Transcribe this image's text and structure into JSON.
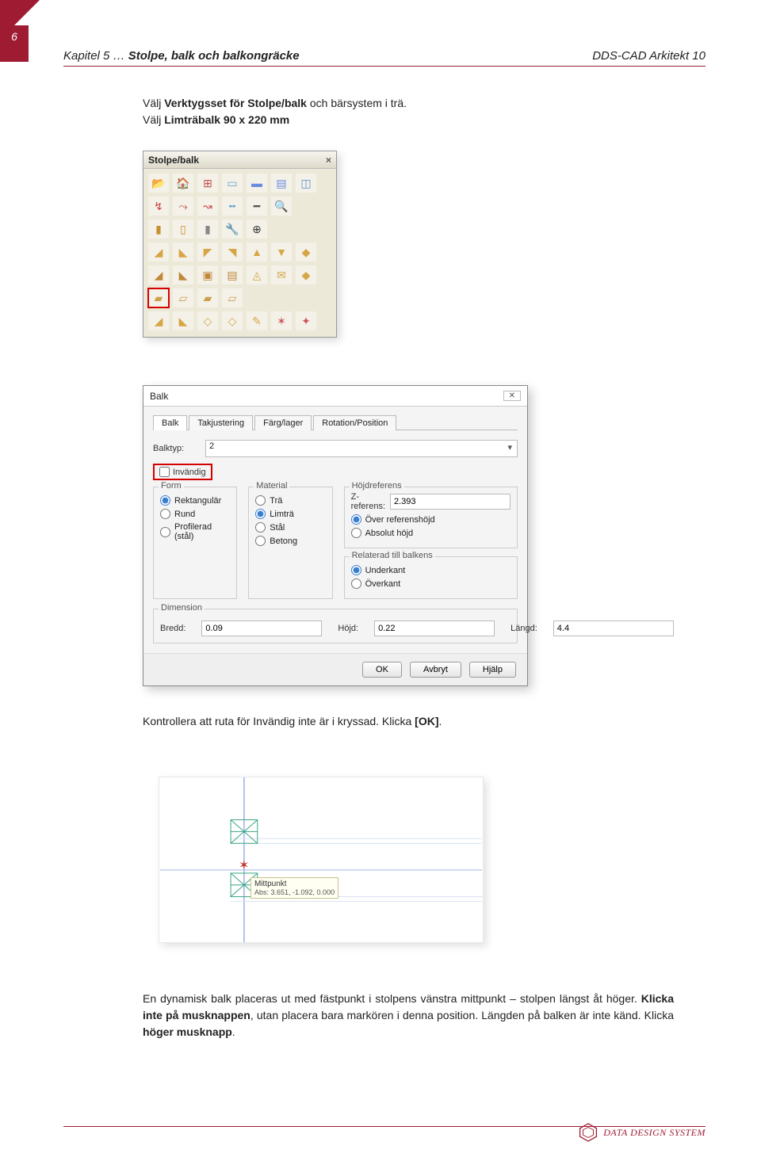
{
  "pageNumber": "6",
  "chapter": {
    "prefix": "Kapitel 5 … ",
    "title": "Stolpe, balk och balkongräcke",
    "right": "DDS-CAD Arkitekt 10"
  },
  "intro": {
    "line1a": "Välj ",
    "line1b": "Verktygsset för Stolpe/balk",
    "line1c": " och bärsystem i trä.",
    "line2a": "Välj ",
    "line2b": "Limträbalk 90 x 220 mm"
  },
  "toolbar": {
    "title": "Stolpe/balk",
    "closeGlyph": "×"
  },
  "dialog": {
    "title": "Balk",
    "closeGlyph": "✕",
    "tabs": [
      "Balk",
      "Takjustering",
      "Färg/lager",
      "Rotation/Position"
    ],
    "balktypLabel": "Balktyp:",
    "balktypValue": "2",
    "invandigLabel": "Invändig",
    "formTitle": "Form",
    "formOptions": [
      "Rektangulär",
      "Rund",
      "Profilerad (stål)"
    ],
    "materialTitle": "Material",
    "materialOptions": [
      "Trä",
      "Limträ",
      "Stål",
      "Betong"
    ],
    "hojdrefTitle": "Höjdreferens",
    "zrefLabel": "Z-referens:",
    "zrefValue": "2.393",
    "hojdrefOptions": [
      "Över referenshöjd",
      "Absolut höjd"
    ],
    "relTitle": "Relaterad till balkens",
    "relOptions": [
      "Underkant",
      "Överkant"
    ],
    "dimTitle": "Dimension",
    "breddLabel": "Bredd:",
    "breddValue": "0.09",
    "hojdLabel": "Höjd:",
    "hojdValue": "0.22",
    "langdLabel": "Längd:",
    "langdValue": "4.4",
    "buttons": {
      "ok": "OK",
      "cancel": "Avbryt",
      "help": "Hjälp"
    }
  },
  "check": {
    "a": "Kontrollera att ruta för Invändig inte är i kryssad. Klicka ",
    "b": "[OK]",
    "c": "."
  },
  "drawing": {
    "tipTitle": "Mittpunkt",
    "tipCoords": "Abs: 3.651, -1.092, 0.000"
  },
  "para3": {
    "a": "En dynamisk balk placeras ut med fästpunkt i stolpens vänstra mittpunkt – stolpen längst åt höger. ",
    "b": "Klicka inte på musknappen",
    "c": ", utan placera bara markören i denna position. Längden på balken är inte känd. Klicka ",
    "d": "höger musknapp",
    "e": "."
  },
  "footer": {
    "brand": "DATA DESIGN SYSTEM"
  }
}
